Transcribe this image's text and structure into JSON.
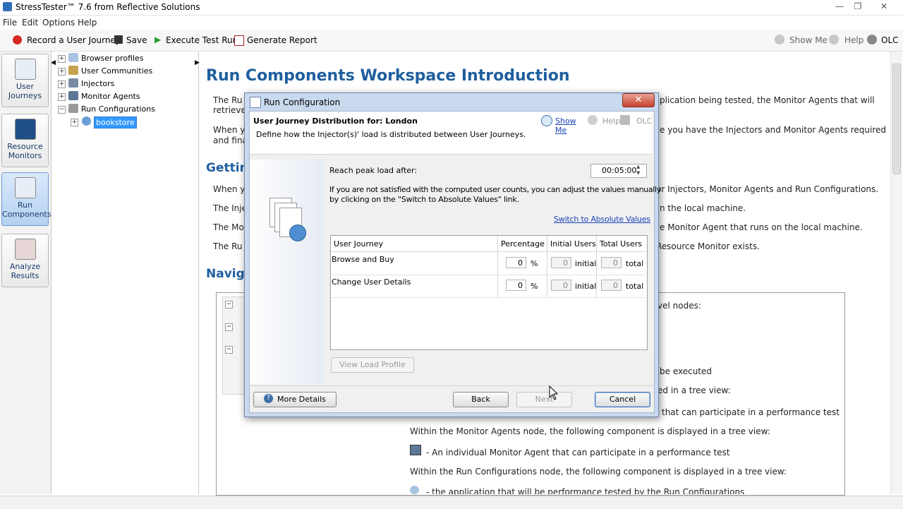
{
  "window": {
    "title": "StressTester™ 7.6 from Reflective Solutions"
  },
  "menu": [
    "File",
    "Edit",
    "Options",
    "Help"
  ],
  "toolbar": {
    "record": "Record a User Journey",
    "save": "Save",
    "execute": "Execute Test Run",
    "report": "Generate Report",
    "show_me": "Show Me",
    "help": "Help",
    "olc": "OLC"
  },
  "nav": [
    {
      "line1": "User",
      "line2": "Journeys"
    },
    {
      "line1": "Resource",
      "line2": "Monitors"
    },
    {
      "line1": "Run",
      "line2": "Components"
    },
    {
      "line1": "Analyze",
      "line2": "Results"
    }
  ],
  "tree": {
    "items": [
      "Browser profiles",
      "User Communities",
      "Injectors",
      "Monitor Agents",
      "Run Configurations"
    ],
    "child": "bookstore"
  },
  "workspace": {
    "title": "Run Components Workspace Introduction",
    "p1a": "The Ru",
    "p1b": "retrieve",
    "p1r": "plication being tested, the Monitor Agents that will",
    "p2a": "When y",
    "p2b": "and fina",
    "p2r": "e you have the Injectors and Monitor Agents required",
    "h_getting": "Gettin",
    "p3a": "When y",
    "p3r": "or Injectors, Monitor Agents and Run Configurations.",
    "p4a": "The Inje",
    "p4r": "n the local machine.",
    "p5a": "The Mo",
    "p5r": "e Monitor Agent that runs on the local machine.",
    "p6a": "The Ru",
    "p6r": "Resource Monitor exists.",
    "h_navig": "Naviga",
    "r1": "vel nodes:",
    "r2": "be executed",
    "r3": "ed in a tree view:",
    "r4": "that can participate in a performance test",
    "r5": "Within the Monitor Agents node, the following component is displayed in a tree view:",
    "r6": "- An individual Monitor Agent that can participate in a performance test",
    "r7": "Within the Run Configurations node, the following component is displayed in a tree view:",
    "r8": "- the application that will be performance tested by the Run Configurations"
  },
  "dialog": {
    "title": "Run Configuration",
    "header_title": "User Journey Distribution for: London",
    "header_sub": "Define how the Injector(s)' load is distributed between User Journeys.",
    "show_me": "Show Me",
    "help": "Help",
    "olc": "OLC",
    "peak_label": "Reach peak load after:",
    "peak_value": "00:05:00",
    "info1": "If you are not satisfied with the computed user counts, you can adjust the values manually",
    "info2": "by clicking on the \"Switch to Absolute Values\" link.",
    "switch_link": "Switch to Absolute Values",
    "columns": [
      "User Journey",
      "Percentage",
      "Initial Users",
      "Total Users"
    ],
    "rows": [
      {
        "name": "Browse and Buy",
        "pct": "0",
        "pct_unit": "%",
        "initial": "0",
        "initial_unit": "initial",
        "total": "0",
        "total_unit": "total"
      },
      {
        "name": "Change User Details",
        "pct": "0",
        "pct_unit": "%",
        "initial": "0",
        "initial_unit": "initial",
        "total": "0",
        "total_unit": "total"
      }
    ],
    "view_load_profile": "View Load Profile",
    "more_details": "More Details",
    "back": "Back",
    "next": "Next",
    "cancel": "Cancel"
  },
  "colors": {
    "heading_blue": "#1f5f9e",
    "selection": "#3399ff",
    "dialog_frame": "#c9d9ee"
  }
}
